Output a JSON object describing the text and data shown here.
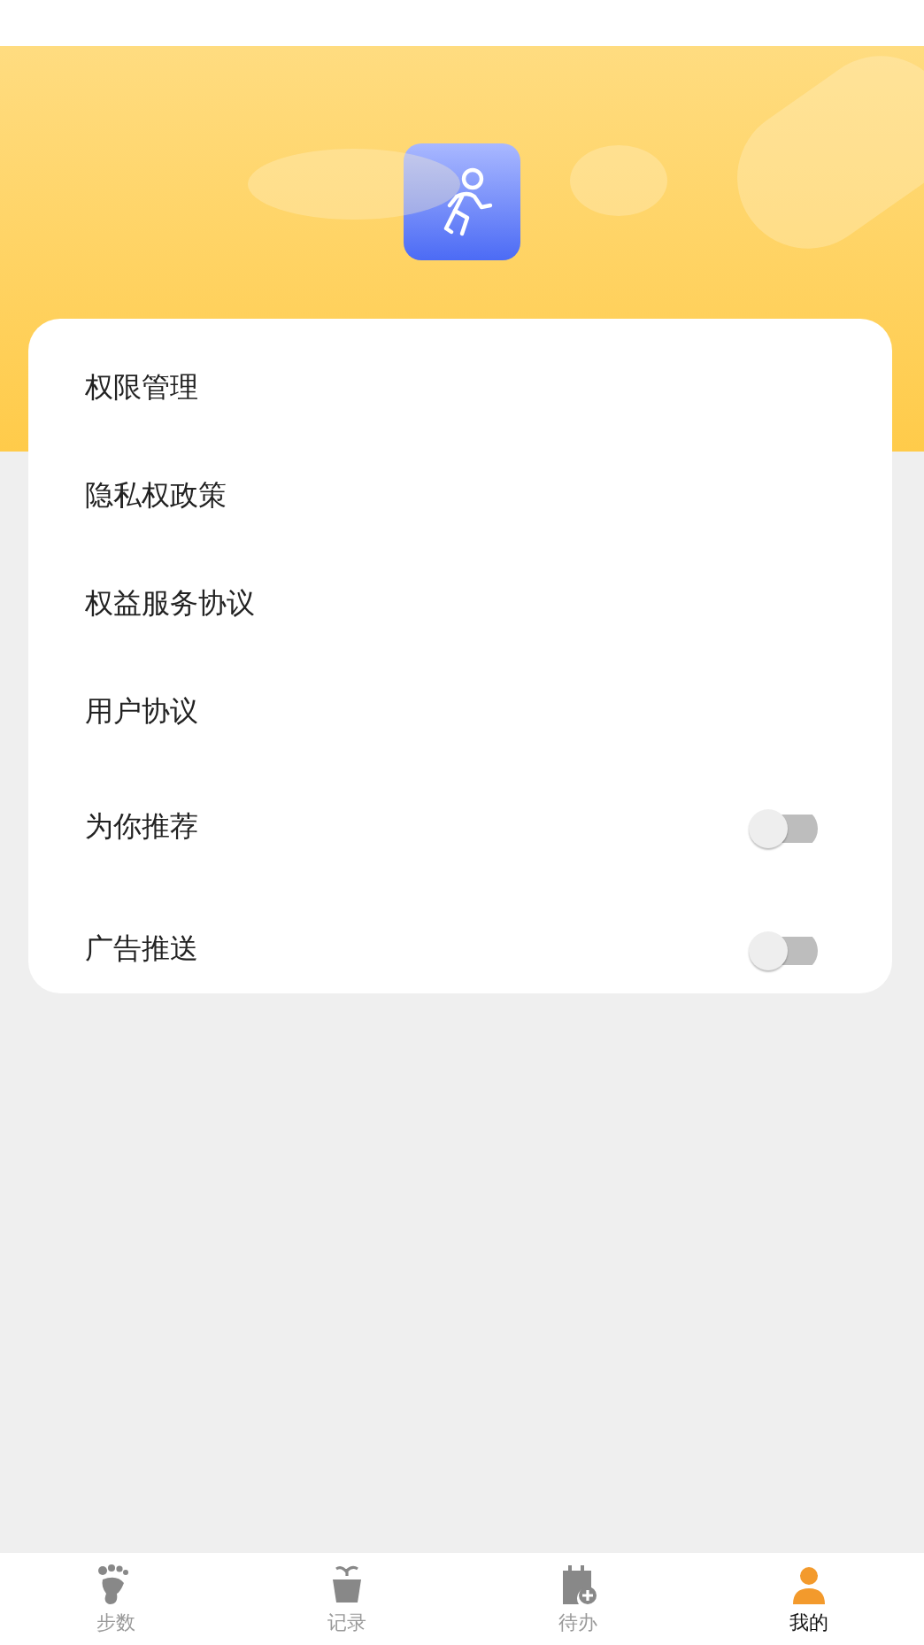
{
  "menu": [
    {
      "kind": "link",
      "label": "权限管理"
    },
    {
      "kind": "link",
      "label": "隐私权政策"
    },
    {
      "kind": "link",
      "label": "权益服务协议"
    },
    {
      "kind": "link",
      "label": "用户协议"
    },
    {
      "kind": "toggle",
      "label": "为你推荐",
      "on": false
    },
    {
      "kind": "toggle",
      "label": "广告推送",
      "on": false
    }
  ],
  "tab_bar": [
    {
      "label": "步数",
      "kind": "steps",
      "selected": false
    },
    {
      "label": "记录",
      "kind": "records",
      "selected": false
    },
    {
      "label": "待办",
      "kind": "todo",
      "selected": false
    },
    {
      "label": "我的",
      "kind": "profile",
      "selected": true
    }
  ]
}
